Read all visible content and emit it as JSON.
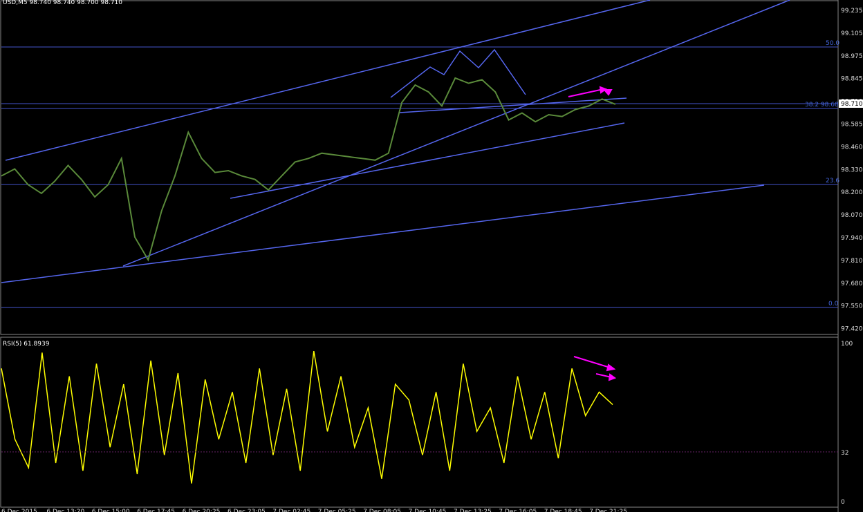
{
  "header": {
    "main_title": "USD,M5  98.740 98.740 98.700 98.710"
  },
  "rsi": {
    "title": "RSI(5) 61.8939",
    "levels": [
      "100",
      "32",
      "0"
    ]
  },
  "price_axis": [
    "99.235",
    "99.105",
    "98.975",
    "98.845",
    "98.710",
    "98.585",
    "98.460",
    "98.330",
    "98.200",
    "98.070",
    "97.940",
    "97.810",
    "97.680",
    "97.550",
    "97.420"
  ],
  "fib": {
    "level_50": "50.0",
    "level_382": "38.2  98.685",
    "level_236": "23.6",
    "level_0": "0.0"
  },
  "current_price": "98.710",
  "time_axis": [
    "6 Dec 2015",
    "6 Dec 13:20",
    "6 Dec 15:00",
    "6 Dec 17:45",
    "6 Dec 20:25",
    "6 Dec 23:05",
    "7 Dec 02:45",
    "7 Dec 05:25",
    "7 Dec 08:05",
    "7 Dec 10:45",
    "7 Dec 13:25",
    "7 Dec 16:05",
    "7 Dec 18:45",
    "7 Dec 21:25"
  ],
  "colors": {
    "grid_line": "#4455cc",
    "trend": "#5566ee",
    "candle": "#5a8a3a",
    "rsi": "#ffff00",
    "arrow": "#ff00ff",
    "price_box": "#ffffff"
  },
  "chart_data": [
    {
      "type": "line",
      "title": "USD,M5  98.740 98.740 98.700 98.710",
      "series": [
        {
          "name": "",
          "values": [
            98.3,
            98.34,
            98.25,
            98.2,
            98.27,
            98.36,
            98.28,
            98.18,
            98.25,
            98.4,
            97.95,
            97.82,
            98.1,
            98.3,
            98.55,
            98.4,
            98.32,
            98.33,
            98.3,
            98.28,
            98.22,
            98.3,
            98.38,
            98.4,
            98.43,
            98.42,
            98.41,
            98.4,
            98.39,
            98.43,
            98.72,
            98.82,
            98.78,
            98.7,
            98.86,
            98.83,
            98.85,
            98.78,
            98.62,
            98.66,
            98.61,
            98.65,
            98.64,
            98.68,
            98.7,
            98.74,
            98.71
          ]
        }
      ],
      "ylim": [
        97.42,
        99.3
      ]
    },
    {
      "type": "line",
      "title": "RSI(5) 61.8939",
      "series": [
        {
          "name": "",
          "values": [
            85,
            40,
            22,
            95,
            25,
            80,
            20,
            88,
            35,
            75,
            18,
            90,
            30,
            82,
            12,
            78,
            40,
            70,
            25,
            85,
            30,
            72,
            20,
            96,
            45,
            80,
            35,
            60,
            15,
            75,
            65,
            30,
            70,
            20,
            88,
            45,
            60,
            25,
            80,
            40,
            70,
            28,
            85,
            55,
            70,
            62
          ]
        }
      ],
      "ylim": [
        0,
        100
      ]
    }
  ]
}
